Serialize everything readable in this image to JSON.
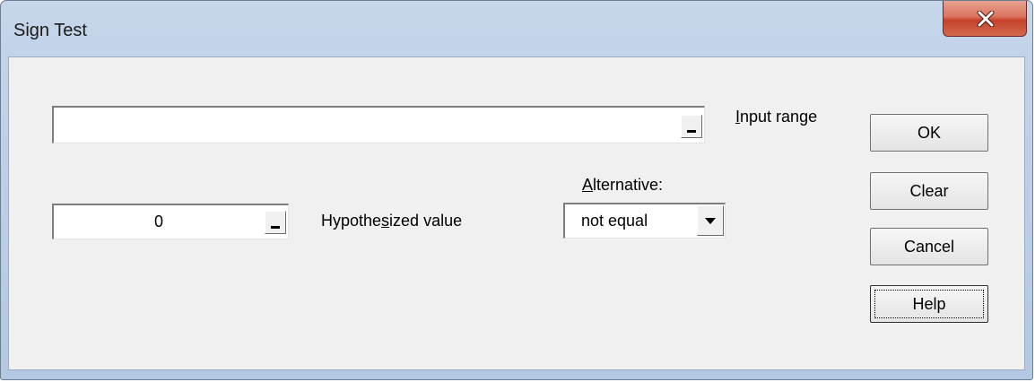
{
  "window": {
    "title": "Sign Test"
  },
  "input_range": {
    "value": "",
    "label_prefix": "",
    "label_underlined": "I",
    "label_suffix": "nput range"
  },
  "hypothesized": {
    "value": "0",
    "label_prefix": "Hypothe",
    "label_underlined": "s",
    "label_suffix": "ized value"
  },
  "alternative": {
    "label_prefix": "",
    "label_underlined": "A",
    "label_suffix": "lternative:",
    "selected": "not equal"
  },
  "buttons": {
    "ok": "OK",
    "clear": "Clear",
    "cancel": "Cancel",
    "help": "Help"
  },
  "icons": {
    "close": "close-icon",
    "ref": "range-selector-icon",
    "dropdown": "chevron-down-icon"
  },
  "colors": {
    "close_button": "#c5412b",
    "window_frame": "#bcd0e8",
    "client_bg": "#f0f0f0"
  }
}
